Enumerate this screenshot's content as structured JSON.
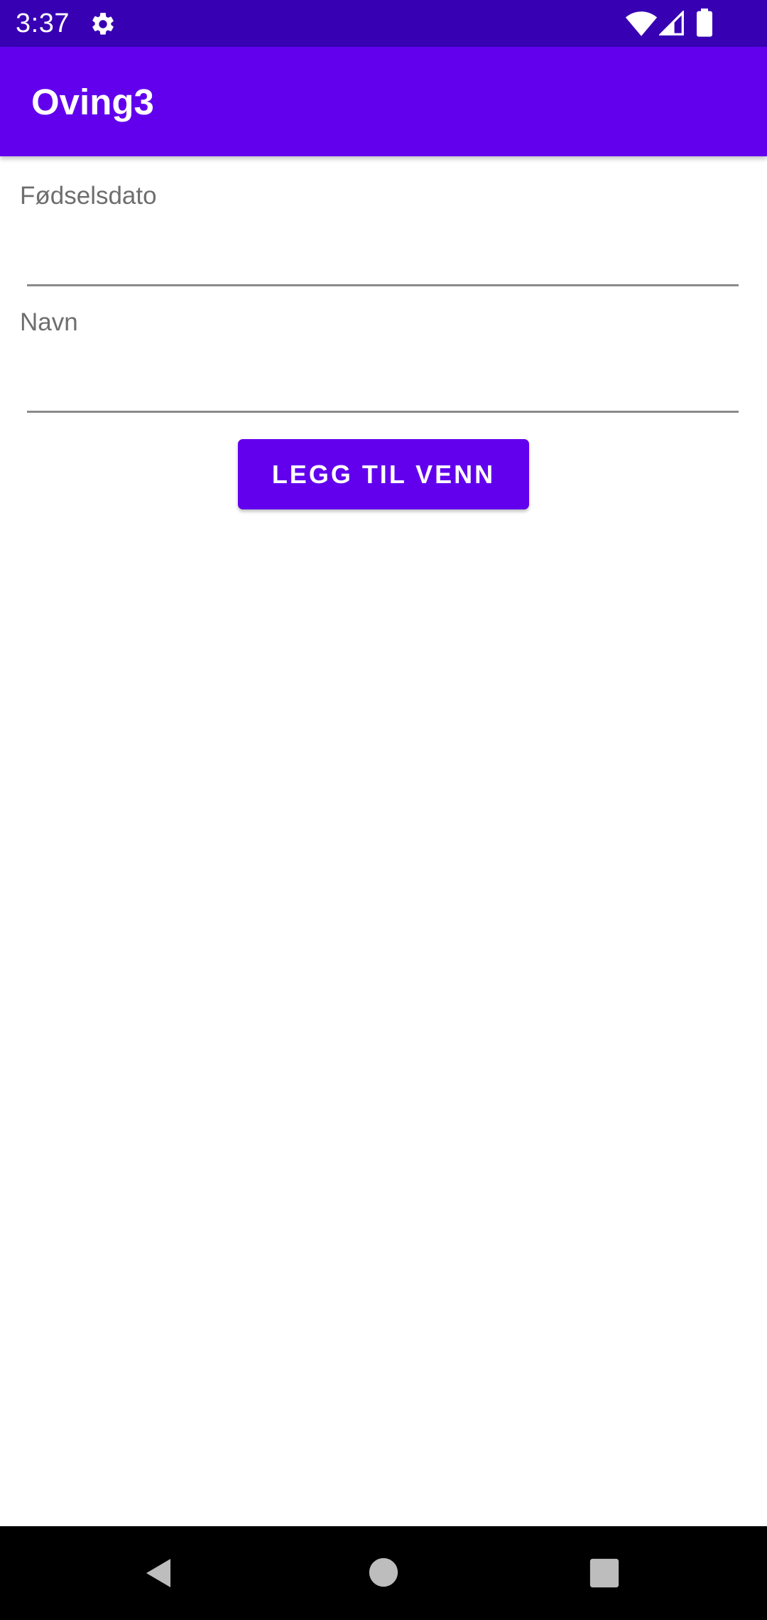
{
  "status_bar": {
    "time": "3:37",
    "icons": [
      "gear-icon",
      "wifi-icon",
      "signal-icon",
      "battery-icon"
    ]
  },
  "app_bar": {
    "title": "Oving3"
  },
  "form": {
    "birthdate_label": "Fødselsdato",
    "birthdate_value": "",
    "name_label": "Navn",
    "name_value": "",
    "add_button_label": "LEGG TIL VENN"
  },
  "nav_bar": {
    "icons": [
      "back-icon",
      "home-icon",
      "recents-icon"
    ]
  },
  "colors": {
    "status_bar": "#3700b3",
    "primary": "#6200ee",
    "on_primary": "#ffffff",
    "label_text": "#6e6e6e",
    "nav_bar": "#000000"
  }
}
